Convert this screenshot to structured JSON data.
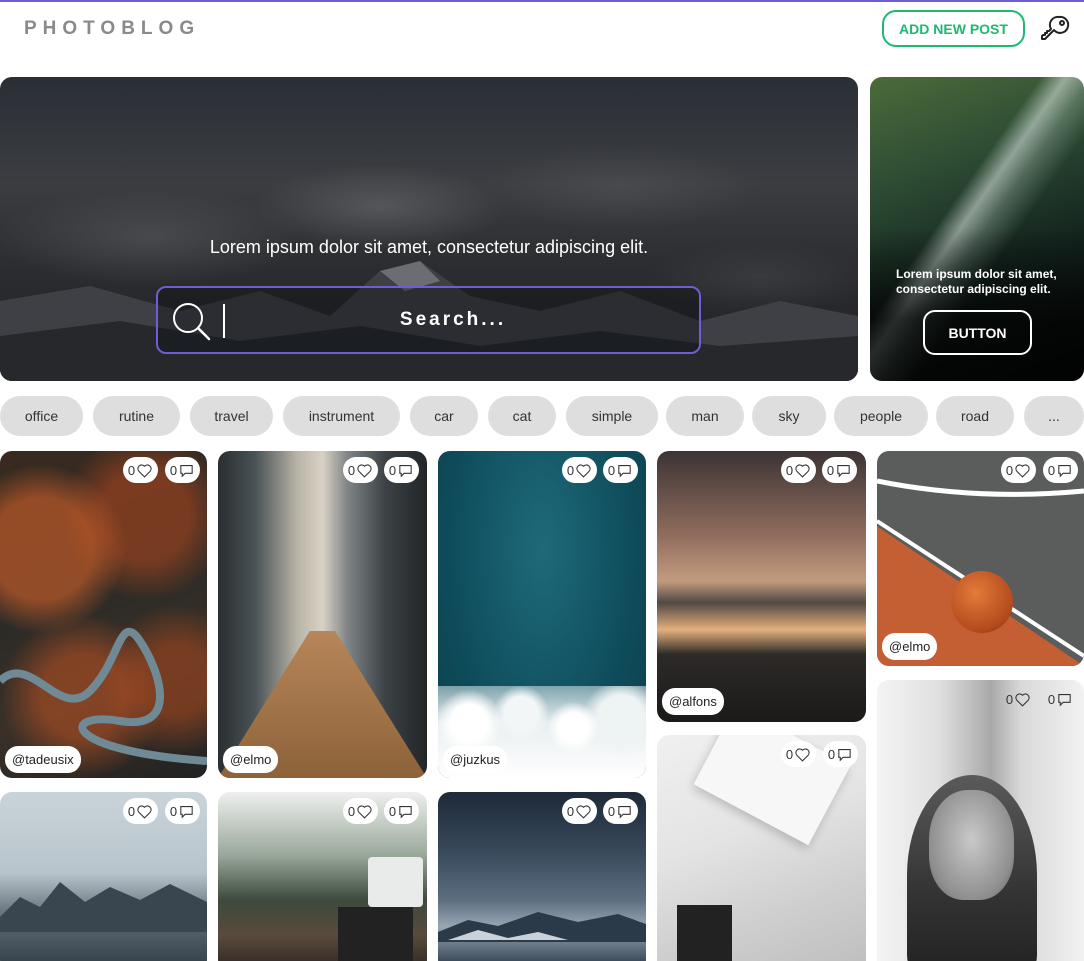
{
  "header": {
    "logo": "PHOTOBLOG",
    "add_post_label": "ADD NEW POST",
    "accent_color": "#1db971"
  },
  "hero": {
    "tagline": "Lorem ipsum dolor sit amet, consectetur adipiscing elit.",
    "search_placeholder": "Search...",
    "search_border_color": "#6c5fd3"
  },
  "promo": {
    "text": "Lorem ipsum dolor sit amet, consectetur adipiscing elit.",
    "button_label": "BUTTON"
  },
  "tags": [
    "office",
    "rutine",
    "travel",
    "instrument",
    "car",
    "cat",
    "simple",
    "man",
    "sky",
    "people",
    "road",
    "..."
  ],
  "posts": [
    {
      "likes": "0",
      "comments": "0",
      "user": "@tadeusix"
    },
    {
      "likes": "0",
      "comments": "0",
      "user": "@elmo"
    },
    {
      "likes": "0",
      "comments": "0",
      "user": "@juzkus"
    },
    {
      "likes": "0",
      "comments": "0",
      "user": "@alfons"
    },
    {
      "likes": "0",
      "comments": "0",
      "user": "@elmo"
    },
    {
      "likes": "0",
      "comments": "0"
    },
    {
      "likes": "0",
      "comments": "0"
    },
    {
      "likes": "0",
      "comments": "0"
    },
    {
      "likes": "0",
      "comments": "0"
    },
    {
      "likes": "0",
      "comments": "0"
    }
  ]
}
